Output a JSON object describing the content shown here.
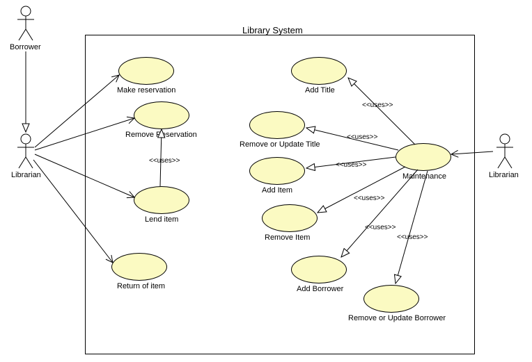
{
  "diagram": {
    "system_title": "Library System",
    "actors": {
      "borrower": "Borrower",
      "librarian_left": "Librarian",
      "librarian_right": "Librarian"
    },
    "usecases": {
      "make_reservation": "Make reservation",
      "remove_reservation": "Remove Reservation",
      "lend_item": "Lend item",
      "return_item": "Return of item",
      "add_title": "Add Title",
      "remove_update_title": "Remove or Update Title",
      "add_item": "Add Item",
      "remove_item": "Remove Item",
      "add_borrower": "Add Borrower",
      "remove_update_borrower": "Remove or Update Borrower",
      "maintenance": "Maintenance"
    },
    "stereotype": "<<uses>>"
  },
  "chart_data": {
    "type": "uml-use-case",
    "system": "Library System",
    "actors": [
      "Borrower",
      "Librarian"
    ],
    "use_cases": [
      "Make reservation",
      "Remove Reservation",
      "Lend item",
      "Return of item",
      "Add Title",
      "Remove or Update Title",
      "Add Item",
      "Remove Item",
      "Add Borrower",
      "Remove or Update Borrower",
      "Maintenance"
    ],
    "associations": [
      {
        "from": "Borrower",
        "to": "Librarian",
        "type": "association"
      },
      {
        "from": "Librarian",
        "to": "Make reservation",
        "type": "association"
      },
      {
        "from": "Librarian",
        "to": "Remove Reservation",
        "type": "association"
      },
      {
        "from": "Librarian",
        "to": "Lend item",
        "type": "association"
      },
      {
        "from": "Librarian",
        "to": "Return of item",
        "type": "association"
      },
      {
        "from": "Librarian",
        "to": "Maintenance",
        "type": "association"
      },
      {
        "from": "Lend item",
        "to": "Remove Reservation",
        "type": "uses"
      },
      {
        "from": "Maintenance",
        "to": "Add Title",
        "type": "uses"
      },
      {
        "from": "Maintenance",
        "to": "Remove or Update Title",
        "type": "uses"
      },
      {
        "from": "Maintenance",
        "to": "Add Item",
        "type": "uses"
      },
      {
        "from": "Maintenance",
        "to": "Remove Item",
        "type": "uses"
      },
      {
        "from": "Maintenance",
        "to": "Add Borrower",
        "type": "uses"
      },
      {
        "from": "Maintenance",
        "to": "Remove or Update Borrower",
        "type": "uses"
      }
    ]
  }
}
